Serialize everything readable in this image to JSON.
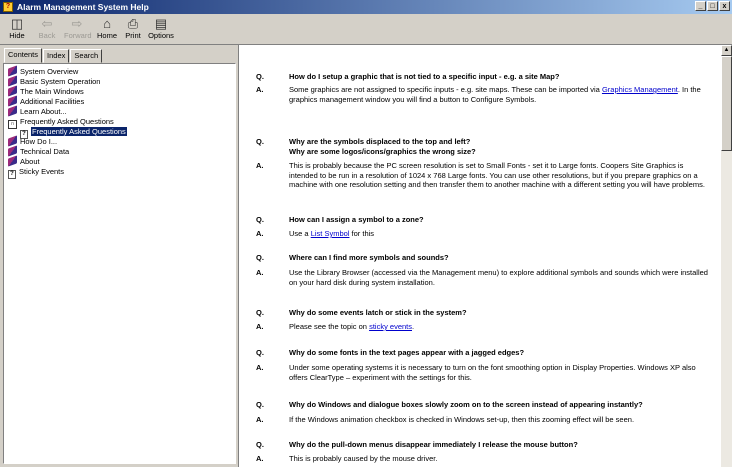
{
  "window": {
    "title": "Alarm Management System Help",
    "min": "_",
    "max": "□",
    "close": "x"
  },
  "toolbar": {
    "hide": "Hide",
    "back": "Back",
    "forward": "Forward",
    "home": "Home",
    "print": "Print",
    "options": "Options"
  },
  "tabs": [
    "Contents",
    "Index",
    "Search"
  ],
  "tree": [
    "System Overview",
    "Basic System Operation",
    "The Main Windows",
    "Additional Facilities",
    "Learn About...",
    "Frequently Asked Questions",
    "Frequently Asked Questions",
    "How Do I...",
    "Technical Data",
    "About",
    "Sticky Events"
  ],
  "faq": {
    "q_label": "Q.",
    "a_label": "A.",
    "items": [
      {
        "q": "How do I setup a graphic that is not tied to a specific input - e.g. a site Map?",
        "a_pre": "Some graphics are not assigned to specific inputs - e.g. site maps. These can be imported via ",
        "a_link": "Graphics Management",
        "a_post": ". In the graphics management window you will find a button to Configure Symbols."
      },
      {
        "q": "Why are the symbols displaced to the top and left?",
        "q2": "Why are some logos/icons/graphics the wrong size?",
        "a": "This is probably because the PC screen resolution is set to Small Fonts - set it to Large fonts. Coopers Site Graphics  is intended to be run in a resolution of 1024 x 768 Large fonts. You can use other resolutions, but if you prepare graphics on a machine with one resolution setting and then transfer them to another machine with a different setting you will have problems."
      },
      {
        "q": "How can I assign a symbol to a zone?",
        "a_pre": "Use a ",
        "a_link": "List Symbol",
        "a_post": " for this"
      },
      {
        "q": "Where can I find more symbols and sounds?",
        "a": "Use the Library Browser (accessed via the Management menu) to explore additional symbols and sounds which were installed on your hard disk during system installation."
      },
      {
        "q": "Why do some events latch or stick in the system?",
        "a_pre": "Please see the topic on ",
        "a_link": "sticky events",
        "a_post": "."
      },
      {
        "q": "Why do some fonts in the text pages appear with a jagged edges?",
        "a": "Under some operating systems it is necessary to turn on the font smoothing option in Display Properties. Windows XP also offers ClearType – experiment with the settings for this."
      },
      {
        "q": "Why do Windows and dialogue boxes slowly zoom on to the screen instead of appearing instantly?",
        "a": "If the Windows animation checkbox is checked in Windows set-up, then this zooming effect will be seen."
      },
      {
        "q": "Why do the pull-down menus disappear immediately I release the mouse button?",
        "a": "This is probably caused by the mouse driver."
      }
    ]
  }
}
